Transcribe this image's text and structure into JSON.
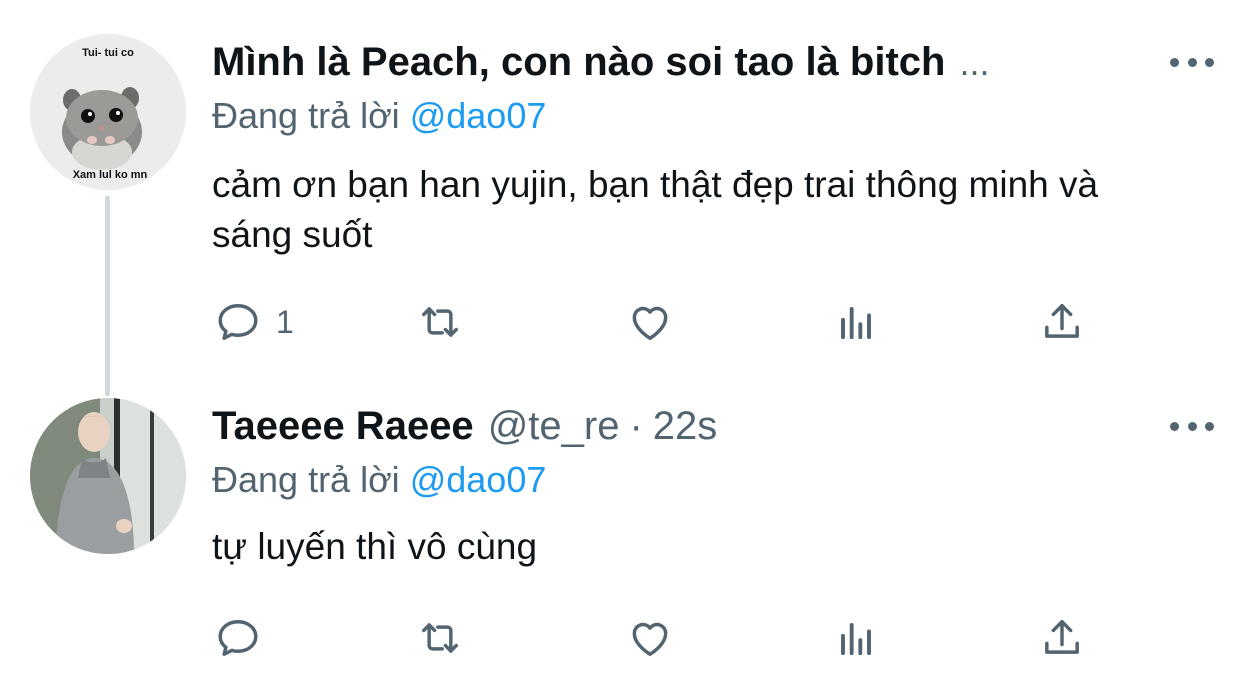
{
  "tweets": [
    {
      "display_name": "Mình là Peach, con nào soi tao là bitch",
      "name_truncation": "...",
      "replying_prefix": "Đang trả lời",
      "replying_to": "@dao07",
      "text": "cảm ơn bạn han yujin, bạn thật đẹp trai thông minh và sáng suốt",
      "avatar_text_top": "Tui- tui co",
      "avatar_text_bottom": "Xam lul ko mn",
      "reply_count": "1"
    },
    {
      "display_name": "Taeeee Raeee",
      "handle": "@te_re",
      "separator": "·",
      "time": "22s",
      "replying_prefix": "Đang trả lời",
      "replying_to": "@dao07",
      "text": "tự luyến thì vô cùng"
    }
  ],
  "icons": {
    "more": "more-dots-icon",
    "reply": "reply-bubble-icon",
    "retweet": "retweet-icon",
    "like": "heart-icon",
    "analytics": "analytics-bars-icon",
    "share": "share-upload-icon"
  },
  "colors": {
    "text": "#0f1419",
    "secondary": "#536471",
    "link": "#1d9bf0",
    "thread_line": "#cfd9de"
  }
}
